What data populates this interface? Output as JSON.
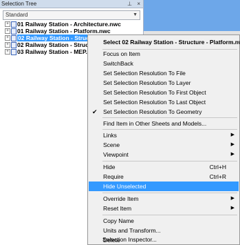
{
  "panel": {
    "title": "Selection Tree",
    "pin_glyph": "⊥",
    "close_glyph": "×",
    "dropdown_value": "Standard"
  },
  "tree": {
    "items": [
      {
        "label": "01 Railway Station - Architecture.nwc",
        "expander": "+",
        "selected": false
      },
      {
        "label": "01 Railway Station - Platform.nwc",
        "expander": "+",
        "selected": false
      },
      {
        "label": "02 Railway Station - Structur",
        "expander": "+",
        "selected": true
      },
      {
        "label": "02 Railway Station - Structur",
        "expander": "+",
        "selected": false
      },
      {
        "label": "03 Railway Station - MEP.nwc",
        "expander": "+",
        "selected": false
      }
    ]
  },
  "context_menu": {
    "title": "Select 02 Railway Station - Structure - Platform.nwc",
    "items": {
      "focus_on_item": "Focus on Item",
      "switchback": "SwitchBack",
      "res_file": "Set Selection Resolution To File",
      "res_layer": "Set Selection Resolution To Layer",
      "res_first": "Set Selection Resolution To First Object",
      "res_last": "Set Selection Resolution To Last Object",
      "res_geometry": "Set Selection Resolution To Geometry",
      "find_item": "Find Item in Other Sheets and Models...",
      "links": "Links",
      "scene": "Scene",
      "viewpoint": "Viewpoint",
      "hide": "Hide",
      "hide_shortcut": "Ctrl+H",
      "require": "Require",
      "require_shortcut": "Ctrl+R",
      "hide_unselected": "Hide Unselected",
      "override_item": "Override Item",
      "reset_item": "Reset Item",
      "copy_name": "Copy Name",
      "units_transform": "Units and Transform...",
      "delete": "Delete",
      "selection_inspector": "Selection Inspector..."
    },
    "checkmark": "✔",
    "submenu_arrow": "▶"
  },
  "colors": {
    "highlight": "#3399ff",
    "menu_bg": "#f0f0f0",
    "panel_header": "#cfdcec"
  }
}
